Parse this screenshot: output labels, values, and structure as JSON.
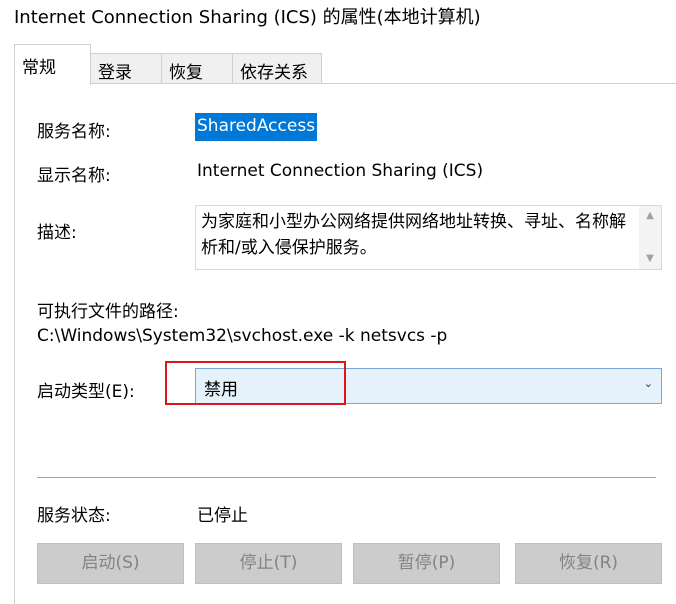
{
  "window": {
    "title": "Internet Connection Sharing (ICS) 的属性(本地计算机)"
  },
  "tabs": [
    {
      "label": "常规",
      "active": true
    },
    {
      "label": "登录",
      "active": false
    },
    {
      "label": "恢复",
      "active": false
    },
    {
      "label": "依存关系",
      "active": false
    }
  ],
  "general": {
    "service_name_label": "服务名称:",
    "service_name_value": "SharedAccess",
    "display_name_label": "显示名称:",
    "display_name_value": "Internet Connection Sharing (ICS)",
    "description_label": "描述:",
    "description_value": "为家庭和小型办公网络提供网络地址转换、寻址、名称解析和/或入侵保护服务。",
    "exe_path_label": "可执行文件的路径:",
    "exe_path_value": "C:\\Windows\\System32\\svchost.exe -k netsvcs -p",
    "startup_type_label": "启动类型(E):",
    "startup_type_value": "禁用",
    "service_status_label": "服务状态:",
    "service_status_value": "已停止"
  },
  "buttons": {
    "start": "启动(S)",
    "stop": "停止(T)",
    "pause": "暂停(P)",
    "resume": "恢复(R)"
  },
  "icons": {
    "scroll_up": "chevron-up-icon",
    "scroll_down": "chevron-down-icon",
    "dropdown": "chevron-down-icon"
  },
  "colors": {
    "selection": "#0078d7",
    "highlight_box": "#e0141e",
    "combo_bg": "#e5f1fb",
    "button_disabled": "#cccccc"
  }
}
